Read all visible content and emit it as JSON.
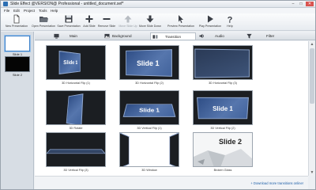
{
  "window": {
    "title": "Slide Effect @VERSION@ Professional - untitled_document.sef*",
    "minimize": "–",
    "maximize": "□",
    "close": "✕"
  },
  "menu": [
    "File",
    "Edit",
    "Project",
    "Tools",
    "Help"
  ],
  "toolbar": [
    {
      "label": "New Presentation",
      "icon": "new-document-icon",
      "enabled": true
    },
    {
      "label": "Open Presentation",
      "icon": "folder-open-icon",
      "enabled": true
    },
    {
      "label": "Save Presentation",
      "icon": "save-icon",
      "enabled": true
    },
    {
      "label": "Add Slide",
      "icon": "plus-icon",
      "enabled": true
    },
    {
      "label": "Remove Slide",
      "icon": "minus-icon",
      "enabled": true
    },
    {
      "label": "Move Slide Up",
      "icon": "arrow-up-icon",
      "enabled": false
    },
    {
      "label": "Move Slide Down",
      "icon": "arrow-down-icon",
      "enabled": true
    },
    {
      "label": "Preview Presentation",
      "icon": "cursor-icon",
      "enabled": true
    },
    {
      "label": "Play Presentation",
      "icon": "play-icon",
      "enabled": true
    },
    {
      "label": "Help",
      "icon": "question-icon",
      "enabled": true
    }
  ],
  "slides": [
    {
      "label": "Slide 1",
      "selected": true
    },
    {
      "label": "Slide 2",
      "selected": false
    }
  ],
  "tabs": [
    {
      "label": "Main",
      "icon": "monitor-icon",
      "active": false
    },
    {
      "label": "Background",
      "icon": "picture-icon",
      "active": false
    },
    {
      "label": "Transition",
      "icon": "transition-icon",
      "active": true
    },
    {
      "label": "Audio",
      "icon": "speaker-icon",
      "active": false
    },
    {
      "label": "Filter",
      "icon": "funnel-icon",
      "active": false
    }
  ],
  "transitions": [
    {
      "caption": "3D Horizontal Flip (1)",
      "preview_text": "Slide 1"
    },
    {
      "caption": "3D Horizontal Flip (2)",
      "preview_text": "Slide 1"
    },
    {
      "caption": "3D Horizontal Flip (3)",
      "preview_text": ""
    },
    {
      "caption": "3D Rotate",
      "preview_text": ""
    },
    {
      "caption": "3D Vertical Flip (1)",
      "preview_text": "Slide 1"
    },
    {
      "caption": "3D Vertical Flip (2)",
      "preview_text": "Slide 1"
    },
    {
      "caption": "3D Vertical Flip (3)",
      "preview_text": ""
    },
    {
      "caption": "3D Window",
      "preview_text": ""
    },
    {
      "caption": "Broken Glass",
      "preview_text": "Slide 2"
    }
  ],
  "footer": {
    "more_link": "+ Download more transitions online!"
  },
  "scrollbar": {
    "up": "▲",
    "down": "▼"
  },
  "colors": {
    "accent": "#3c80c8",
    "slide_blue": "#4a6aa2",
    "preview_bg": "#1b1e22"
  }
}
